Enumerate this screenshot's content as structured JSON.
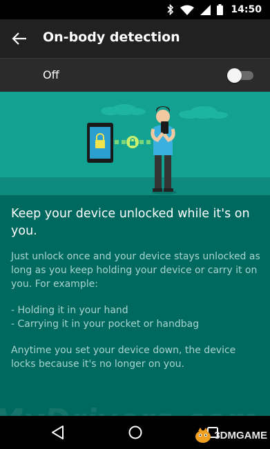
{
  "status_bar": {
    "time": "14:50",
    "icons": [
      "bluetooth-icon",
      "wifi-icon",
      "signal-icon",
      "battery-icon"
    ]
  },
  "app_bar": {
    "title": "On-body detection",
    "back_icon": "arrow-back-icon"
  },
  "master_switch": {
    "label": "Off",
    "state": false
  },
  "content": {
    "headline": "Keep your device unlocked while it's on you.",
    "intro": "Just unlock once and your device stays unlocked as long as you keep holding your device or carry it on you. For example:",
    "examples": [
      "- Holding it in your hand",
      "- Carrying it in your pocket or handbag"
    ],
    "footer": "Anytime you set your device down, the device locks because it's no longer on you."
  },
  "nav_bar": {
    "buttons": [
      "back-triangle-icon",
      "home-circle-icon",
      "recents-square-icon"
    ]
  },
  "watermark": {
    "text": "MyDrivers.com",
    "brand": "3DMGAME"
  },
  "colors": {
    "status_bar": "#000000",
    "app_bar": "#212121",
    "switch_bar": "#2b2b2b",
    "illustration_bg": "#13a192",
    "content_bg": "#00695f",
    "body_text": "#a7d4cf"
  }
}
